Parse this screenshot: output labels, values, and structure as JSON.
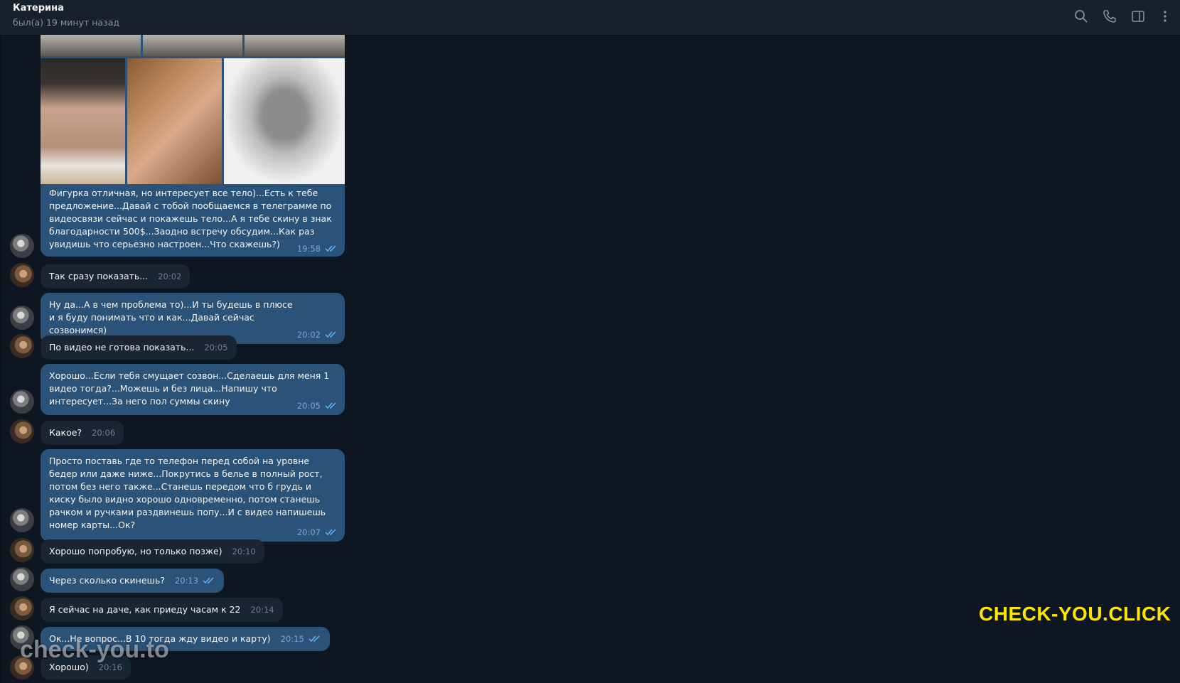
{
  "header": {
    "name": "Катерина",
    "status": "был(а) 19 минут назад",
    "icons": [
      "search-icon",
      "phone-icon",
      "sidebar-toggle-icon",
      "more-vertical-icon"
    ]
  },
  "album": {
    "caption": "Фигурка отличная, но интересует все тело)...Есть к тебе предложение...Давай с тобой пообщаемся в  телеграмме  по видеосвязи сейчас и покажешь тело...А я тебе скину в знак благодарности 500$...Заодно встречу обсудим...Как раз увидишь что серьезно настроен...Что скажешь?)",
    "time": "19:58"
  },
  "messages": [
    {
      "dir": "in",
      "text": "Так сразу показать...",
      "time": "20:02"
    },
    {
      "dir": "out",
      "text": "Ну да...А в чем проблема то)...И ты будешь в плюсе и я буду понимать что и как...Давай сейчас созвонимся)",
      "time": "20:02"
    },
    {
      "dir": "in",
      "text": "По видео не готова показать...",
      "time": "20:05"
    },
    {
      "dir": "out",
      "text": "Хорошо...Если тебя смущает созвон...Сделаешь для меня 1 видео тогда?...Можешь и без лица...Напишу что интересует...За него пол суммы скину",
      "time": "20:05"
    },
    {
      "dir": "in",
      "text": "Какое?",
      "time": "20:06"
    },
    {
      "dir": "out",
      "text": "Просто поставь где то телефон перед собой на уровне бедер или даже ниже...Покрутись в белье в полный рост, потом без него также...Станешь передом что б грудь и киску было видно хорошо одновременно, потом станешь рачком и ручками раздвинешь попу...И с видео напишешь номер карты...Ок?",
      "time": "20:07"
    },
    {
      "dir": "in",
      "text": "Хорошо попробую, но только позже)",
      "time": "20:10"
    },
    {
      "dir": "out",
      "text": "Через сколько скинешь?",
      "time": "20:13"
    },
    {
      "dir": "in",
      "text": "Я сейчас на даче, как приеду часам к 22",
      "time": "20:14"
    },
    {
      "dir": "out",
      "text": "Ок...Не вопрос...В 10 тогда жду видео и карту)",
      "time": "20:15"
    },
    {
      "dir": "in",
      "text": "Хорошо)",
      "time": "20:16"
    }
  ],
  "watermarks": {
    "right": "CHECK-YOU.CLICK",
    "left": "check-you.to"
  },
  "colors": {
    "background": "#0e1621",
    "header": "#17212b",
    "outgoing_bubble": "#2b5278",
    "incoming_bubble": "#182533",
    "accent_ticks": "#5eb5f7",
    "watermark_yellow": "#ffe600"
  }
}
